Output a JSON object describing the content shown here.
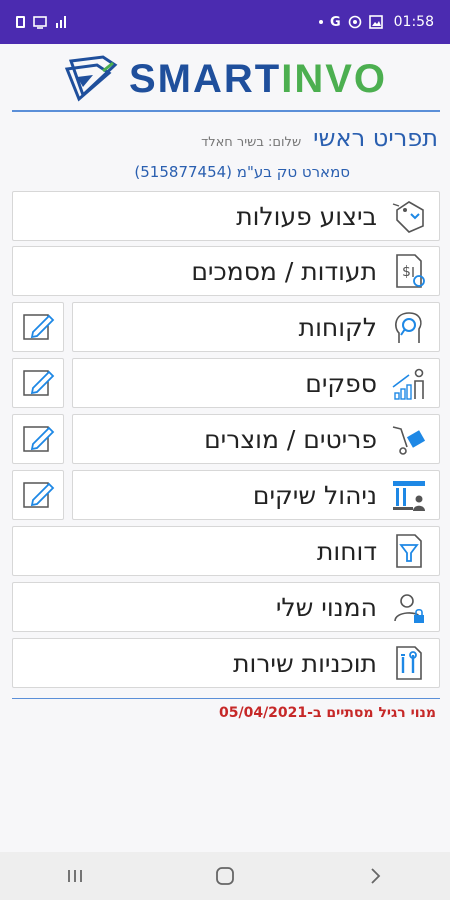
{
  "status_bar": {
    "left_icons": [
      "battery-saver-icon",
      "cast-icon",
      "signal-icon"
    ],
    "right_icons": [
      "dot-icon",
      "google-icon",
      "sync-icon",
      "image-icon"
    ],
    "google_glyph": "G",
    "time": "01:58"
  },
  "logo": {
    "smart": "SMART",
    "invo": "INVO"
  },
  "header": {
    "page_title": "תפריט ראשי",
    "greeting": "שלום: בשיר חאלד",
    "company": "סמארט טק בע\"מ (515877454)"
  },
  "menu": {
    "items": [
      {
        "label": "ביצוע פעולות",
        "icon": "actions-tag-icon"
      },
      {
        "label": "תעודות / מסמכים",
        "icon": "documents-icon"
      },
      {
        "label": "לקוחות",
        "icon": "customers-icon"
      },
      {
        "label": "ספקים",
        "icon": "suppliers-icon"
      },
      {
        "label": "פריטים / מוצרים",
        "icon": "products-icon"
      },
      {
        "label": "ניהול שיקים",
        "icon": "checks-bank-icon"
      },
      {
        "label": "דוחות",
        "icon": "reports-filter-icon"
      },
      {
        "label": "המנוי שלי",
        "icon": "subscription-user-icon"
      },
      {
        "label": "תוכניות שירות",
        "icon": "service-plans-icon"
      }
    ]
  },
  "footer": {
    "subscription_note": "מנוי רגיל מסתיים ב-05/04/2021"
  },
  "colors": {
    "status_bar": "#4b2bb0",
    "brand_blue": "#1f4f9c",
    "brand_green": "#4caf50",
    "title_blue": "#2a5fb0",
    "warning_red": "#c62828"
  }
}
